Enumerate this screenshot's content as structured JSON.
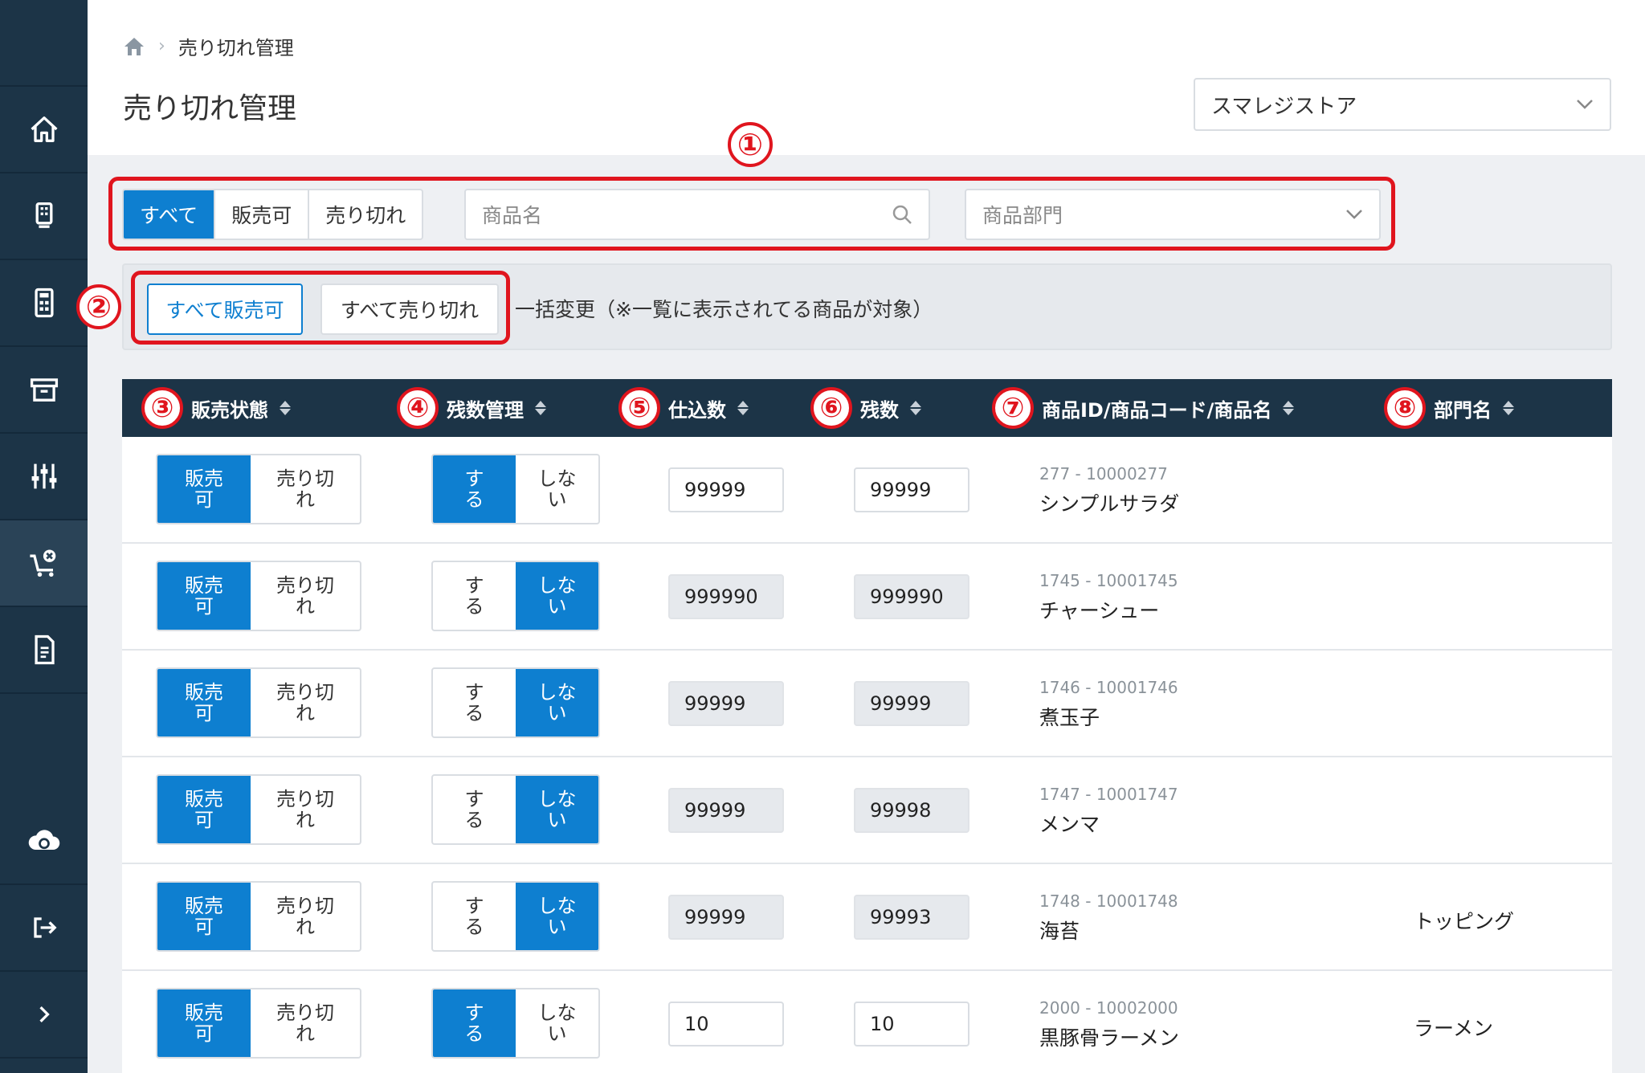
{
  "breadcrumb": {
    "current": "売り切れ管理"
  },
  "page_title": "売り切れ管理",
  "store_select": {
    "value": "スマレジストア"
  },
  "filters": {
    "segments": [
      "すべて",
      "販売可",
      "売り切れ"
    ],
    "active_segment": "すべて",
    "search_placeholder": "商品名",
    "dept_placeholder": "商品部門"
  },
  "bulk": {
    "sell_all_label": "すべて販売可",
    "sold_all_label": "すべて売り切れ",
    "note": "一括変更（※一覧に表示されてる商品が対象）"
  },
  "annotations": [
    "①",
    "②",
    "③",
    "④",
    "⑤",
    "⑥",
    "⑦",
    "⑧"
  ],
  "table": {
    "headers": [
      "販売状態",
      "残数管理",
      "仕込数",
      "残数",
      "商品ID/商品コード/商品名",
      "部門名"
    ],
    "toggle_sale": [
      "販売\n可",
      "売り切\nれ"
    ],
    "toggle_sale_row0": [
      "販売\n可",
      "売り切\nれ"
    ],
    "toggle_manage": [
      "す\nる",
      "しな\nい"
    ],
    "rows": [
      {
        "sale": "販売可",
        "manage": "する",
        "prep": "99999",
        "remain": "99999",
        "id": "277 - 10000277",
        "name": "シンプルサラダ",
        "dept": ""
      },
      {
        "sale": "販売可",
        "manage": "しない",
        "prep": "999990",
        "remain": "999990",
        "id": "1745 - 10001745",
        "name": "チャーシュー",
        "dept": ""
      },
      {
        "sale": "販売可",
        "manage": "しない",
        "prep": "99999",
        "remain": "99999",
        "id": "1746 - 10001746",
        "name": "煮玉子",
        "dept": ""
      },
      {
        "sale": "販売可",
        "manage": "しない",
        "prep": "99999",
        "remain": "99998",
        "id": "1747 - 10001747",
        "name": "メンマ",
        "dept": ""
      },
      {
        "sale": "販売可",
        "manage": "しない",
        "prep": "99999",
        "remain": "99993",
        "id": "1748 - 10001748",
        "name": "海苔",
        "dept": "トッピング"
      },
      {
        "sale": "販売可",
        "manage": "する",
        "prep": "10",
        "remain": "10",
        "id": "2000 - 10002000",
        "name": "黒豚骨ラーメン",
        "dept": "ラーメン"
      }
    ]
  },
  "colors": {
    "sidebar": "#1c3447",
    "accent": "#0e7fd0",
    "annotation": "#e0151e"
  }
}
